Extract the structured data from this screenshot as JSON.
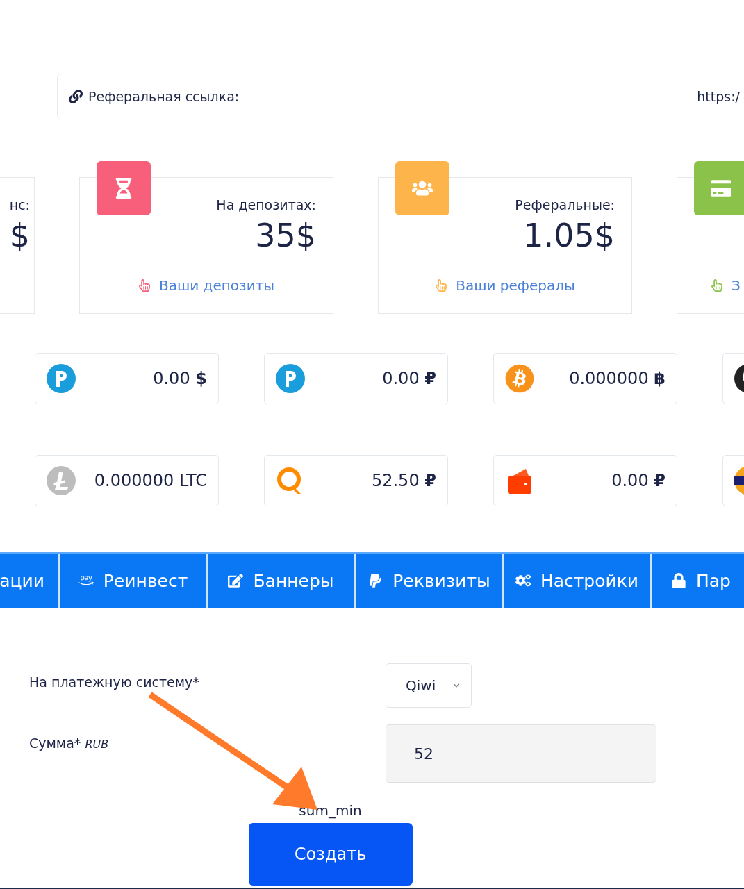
{
  "referral": {
    "label": "Реферальная ссылка:",
    "value": "https:/"
  },
  "stats": [
    {
      "label": "нс:",
      "value": "$",
      "kind": "plain"
    },
    {
      "label": "На депозитах:",
      "value": "35$",
      "kind": "hourglass",
      "color": "#f75f7b",
      "link": "Ваши депозиты"
    },
    {
      "label": "Реферальные:",
      "value": "1.05$",
      "kind": "users",
      "color": "#fdb44b",
      "link": "Ваши рефералы"
    },
    {
      "kind": "card",
      "color": "#8bc34a",
      "link": "З"
    }
  ],
  "wallets": [
    [
      {
        "kind": "payeer",
        "value": "0.00 **$**"
      },
      {
        "kind": "payeer",
        "value": "0.00 **₽**"
      },
      {
        "kind": "bitcoin",
        "value": "0.000000 **฿**"
      },
      {
        "kind": "ethereum"
      }
    ],
    [
      {
        "kind": "litecoin",
        "value": "0.000000 LTC"
      },
      {
        "kind": "qiwi",
        "value": "52.50 **₽**"
      },
      {
        "kind": "wallet",
        "value": "0.00 **₽**"
      },
      {
        "kind": "visa"
      }
    ]
  ],
  "tabs": [
    {
      "label": "ации",
      "kind": "plain",
      "selected": false
    },
    {
      "label": "Реинвест",
      "kind": "pay",
      "selected": false
    },
    {
      "label": "Баннеры",
      "kind": "edit",
      "selected": false
    },
    {
      "label": "Реквизиты",
      "kind": "paypal",
      "selected": false
    },
    {
      "label": "Настройки",
      "kind": "cogs",
      "selected": false
    },
    {
      "label": "Пар",
      "kind": "lock",
      "selected": false
    }
  ],
  "form": {
    "system_label": "На платежную систему*",
    "system_value": "Qiwi",
    "amount_label": "Сумма*",
    "amount_unit": "RUB",
    "amount_value": "52",
    "hint": "sum_min",
    "submit": "Создать"
  }
}
